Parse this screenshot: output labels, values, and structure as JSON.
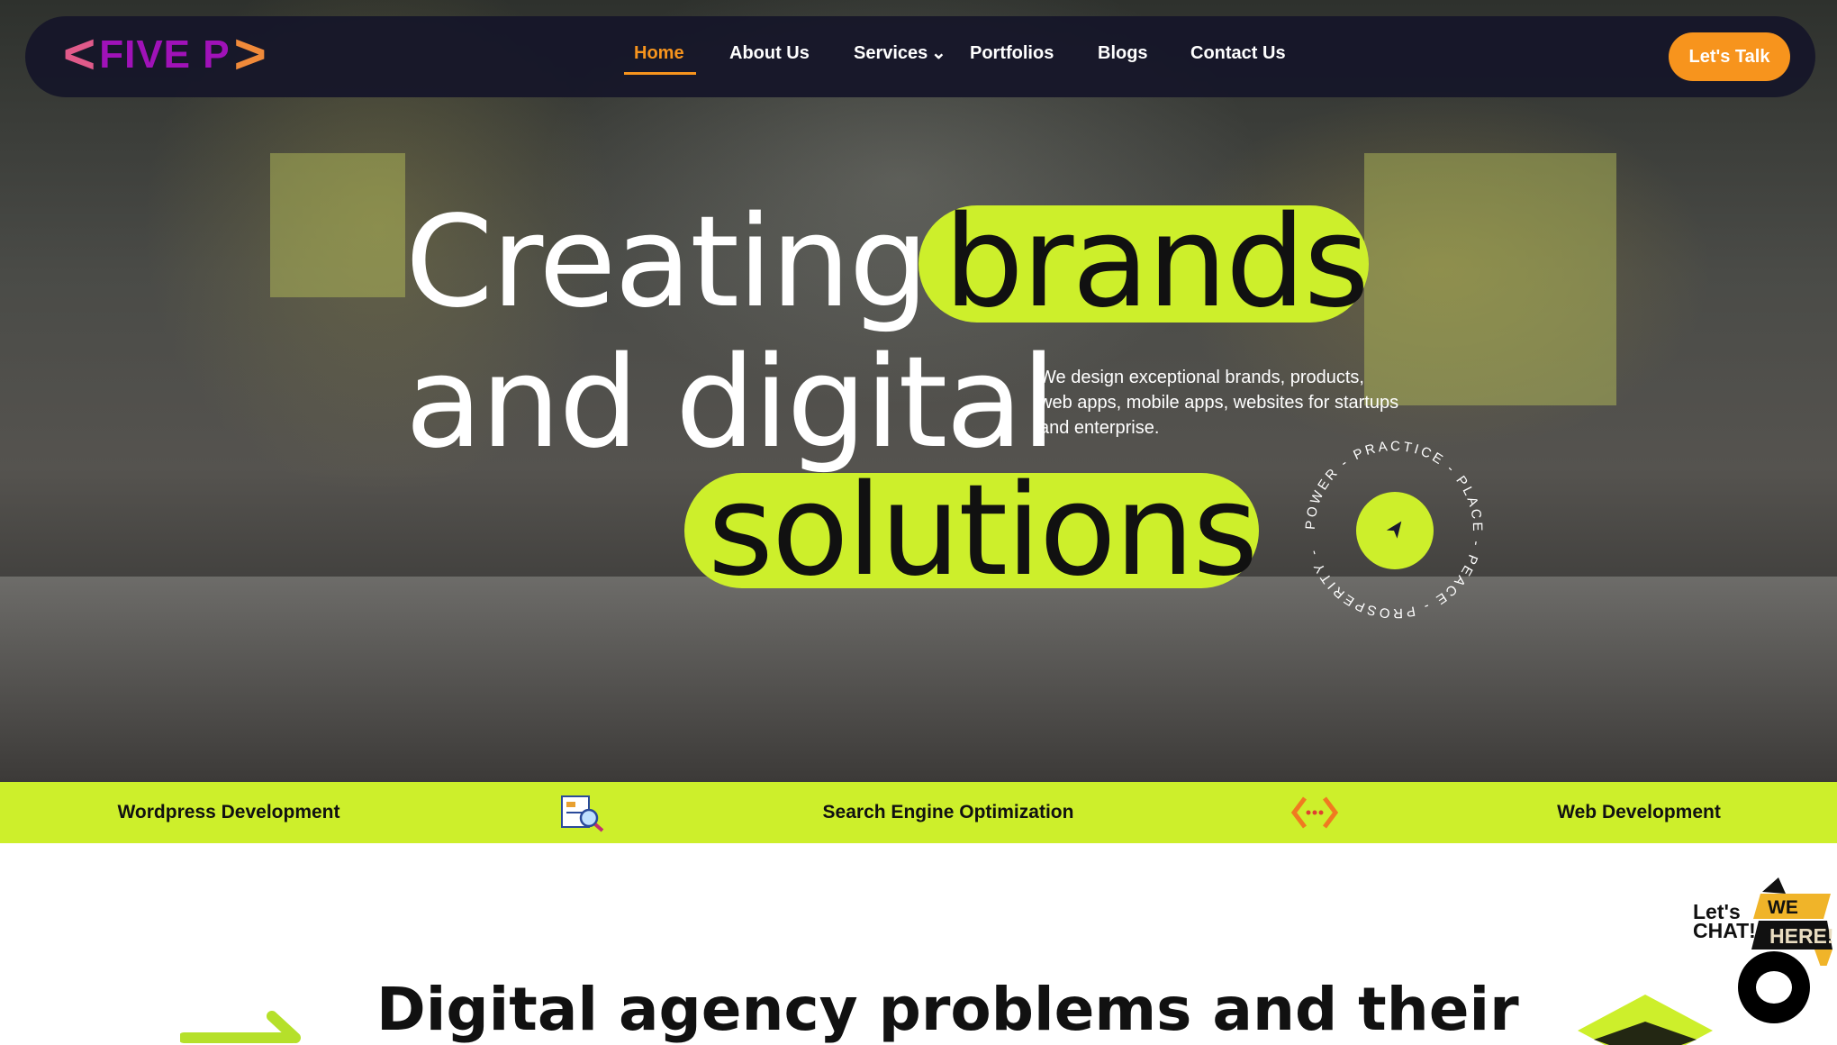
{
  "brand": {
    "logo_text": "FIVE P"
  },
  "nav": {
    "items": [
      "Home",
      "About Us",
      "Services",
      "Portfolios",
      "Blogs",
      "Contact Us"
    ],
    "active": "Home",
    "cta": "Let's Talk"
  },
  "hero": {
    "line1": "Creating",
    "highlight1": "brands",
    "line2": "and digital",
    "highlight2": "solutions",
    "description": "We design exceptional brands, products, web apps, mobile apps, websites for startups and enterprise.",
    "ring_text": "POWER - PRACTICE - PLACE - PEACE - PROSPERITY - "
  },
  "services_strip": {
    "items": [
      "Wordpress Development",
      "Search Engine Optimization",
      "Web Development"
    ]
  },
  "section": {
    "heading": "Digital agency problems and their"
  },
  "chat": {
    "lets_chat": "Let's CHAT!",
    "we_are": "WE ARE",
    "here": "HERE!"
  },
  "colors": {
    "accent": "#cdef2b",
    "orange": "#f7941d",
    "nav_bg": "#171729"
  }
}
